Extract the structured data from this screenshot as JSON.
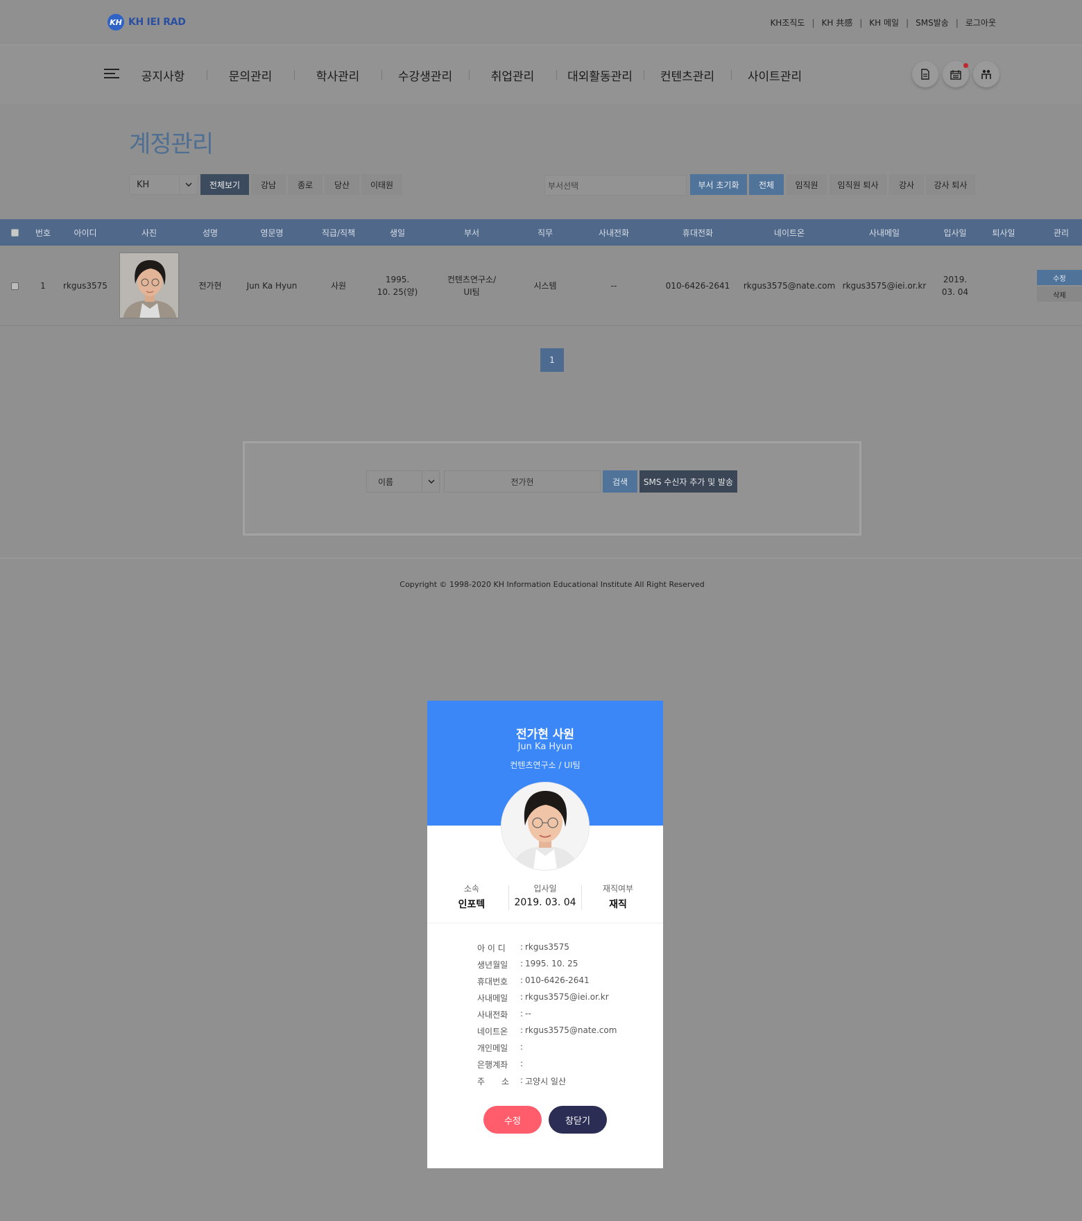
{
  "header": {
    "logo_mark": "KH",
    "logo_text": "KH IEI RAD",
    "util_links": [
      "KH조직도",
      "KH 共感",
      "KH 메일",
      "SMS발송",
      "로그아웃"
    ]
  },
  "nav": {
    "items": [
      "공지사항",
      "문의관리",
      "학사관리",
      "수강생관리",
      "취업관리",
      "대외활동관리",
      "컨텐츠관리",
      "사이트관리"
    ]
  },
  "page": {
    "title": "계정관리"
  },
  "filters": {
    "company_select": "KH",
    "branch_buttons": [
      "전체보기",
      "강남",
      "종로",
      "당산",
      "이태원"
    ],
    "dept_placeholder": "부서선택",
    "dept_reset": "부서 초기화",
    "status_buttons": [
      "전체",
      "임직원",
      "임직원 퇴사",
      "강사",
      "강사 퇴사"
    ]
  },
  "table": {
    "headers": [
      "번호",
      "아이디",
      "사진",
      "성명",
      "영문명",
      "직급/직책",
      "생일",
      "부서",
      "직무",
      "사내전화",
      "휴대전화",
      "네이트온",
      "사내메일",
      "입사일",
      "퇴사일",
      "관리"
    ],
    "rows": [
      {
        "no": "1",
        "id": "rkgus3575",
        "name": "전가현",
        "eng_name": "Jun Ka Hyun",
        "position": "사원",
        "birth_1": "1995.",
        "birth_2": "10. 25(양)",
        "dept_1": "컨텐츠연구소/",
        "dept_2": "UI팀",
        "duty": "시스템",
        "office_phone": "--",
        "mobile": "010-6426-2641",
        "nateon": "rkgus3575@nate.com",
        "email": "rkgus3575@iei.or.kr",
        "join_1": "2019.",
        "join_2": "03. 04",
        "leave": "",
        "edit": "수정",
        "delete": "삭제"
      }
    ]
  },
  "pagination": {
    "current": "1"
  },
  "search": {
    "field": "이름",
    "value": "전가현",
    "search_btn": "검색",
    "sms_btn": "SMS 수신자 추가 및 발송"
  },
  "footer": {
    "copyright": "Copyright © 1998-2020 KH Information Educational Institute All Right Reserved"
  },
  "modal": {
    "name_title": "전가현 사원",
    "eng_name": "Jun Ka Hyun",
    "dept": "컨텐츠연구소 / UI팀",
    "stats": [
      {
        "label": "소속",
        "value": "인포텍"
      },
      {
        "label": "입사일",
        "value": "2019. 03. 04"
      },
      {
        "label": "재직여부",
        "value": "재직"
      }
    ],
    "info": [
      {
        "key": "아 이 디",
        "value": "rkgus3575"
      },
      {
        "key": "생년월일",
        "value": "1995. 10. 25"
      },
      {
        "key": "휴대번호",
        "value": "010-6426-2641"
      },
      {
        "key": "사내메일",
        "value": "rkgus3575@iei.or.kr"
      },
      {
        "key": "사내전화",
        "value": "--"
      },
      {
        "key": "네이트온",
        "value": "rkgus3575@nate.com"
      },
      {
        "key": "개인메일",
        "value": ""
      },
      {
        "key": "은행계좌",
        "value": ""
      },
      {
        "key": "주　　소",
        "value": "고양시 일산"
      }
    ],
    "edit_btn": "수정",
    "close_btn": "창닫기"
  },
  "colors": {
    "modal_header": "#3b87f8",
    "edit_button": "#ff5d6c",
    "close_button": "#2b2d55",
    "table_header": "#50698a"
  }
}
